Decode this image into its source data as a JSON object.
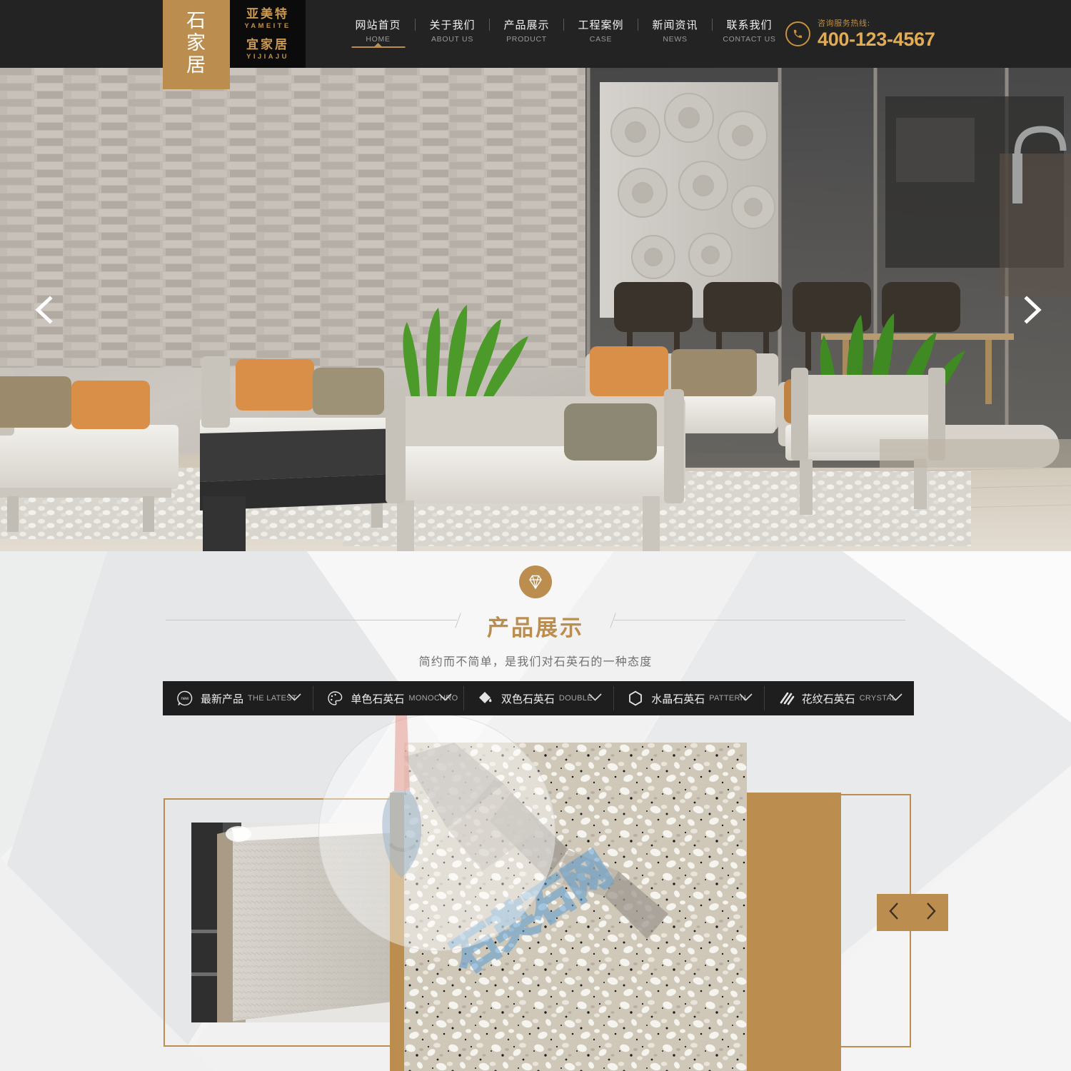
{
  "site": {
    "badge_text": "石家居",
    "logo_cn_1": "亚美特",
    "logo_en_1": "YAMEITE",
    "logo_cn_2": "宜家居",
    "logo_en_2": "YIJIAJU",
    "brand_gold": "#bb8d4f",
    "header_bg": "#232323"
  },
  "nav": {
    "items": [
      {
        "cn": "网站首页",
        "en": "HOME",
        "active": true
      },
      {
        "cn": "关于我们",
        "en": "ABOUT US",
        "active": false
      },
      {
        "cn": "产品展示",
        "en": "PRODUCT",
        "active": false
      },
      {
        "cn": "工程案例",
        "en": "CASE",
        "active": false
      },
      {
        "cn": "新闻资讯",
        "en": "NEWS",
        "active": false
      },
      {
        "cn": "联系我们",
        "en": "CONTACT US",
        "active": false
      }
    ]
  },
  "hotline": {
    "label": "咨询服务热线:",
    "number": "400-123-4567",
    "icon": "phone-icon"
  },
  "hero": {
    "prev_icon": "chevron-left-icon",
    "next_icon": "chevron-right-icon",
    "alt": "现代客厅户外家具展示"
  },
  "section": {
    "badge_icon": "diamond-icon",
    "title": "产品展示",
    "subtitle": "简约而不简单，是我们对石英石的一种态度"
  },
  "tabs": [
    {
      "cn": "最新产品",
      "en": "THE LATEST",
      "icon": "new-bubble-icon",
      "chevron": "chevron-down-icon"
    },
    {
      "cn": "单色石英石",
      "en": "MONOCHRO",
      "icon": "palette-icon",
      "chevron": "chevron-down-icon"
    },
    {
      "cn": "双色石英石",
      "en": "DOUBLE",
      "icon": "paint-bucket-icon",
      "chevron": "chevron-down-icon"
    },
    {
      "cn": "水晶石英石",
      "en": "PATTERN",
      "icon": "hexagon-icon",
      "chevron": "chevron-down-icon"
    },
    {
      "cn": "花纹石英石",
      "en": "CRYSTAL",
      "icon": "diagonal-lines-icon",
      "chevron": "chevron-down-icon"
    }
  ],
  "gallery": {
    "prev_icon": "chevron-left-icon",
    "next_icon": "chevron-right-icon",
    "left_thumb_alt": "石英石台面细节",
    "center_alt": "米色水磨石石英石板材",
    "watermark_text": "石英石网"
  }
}
